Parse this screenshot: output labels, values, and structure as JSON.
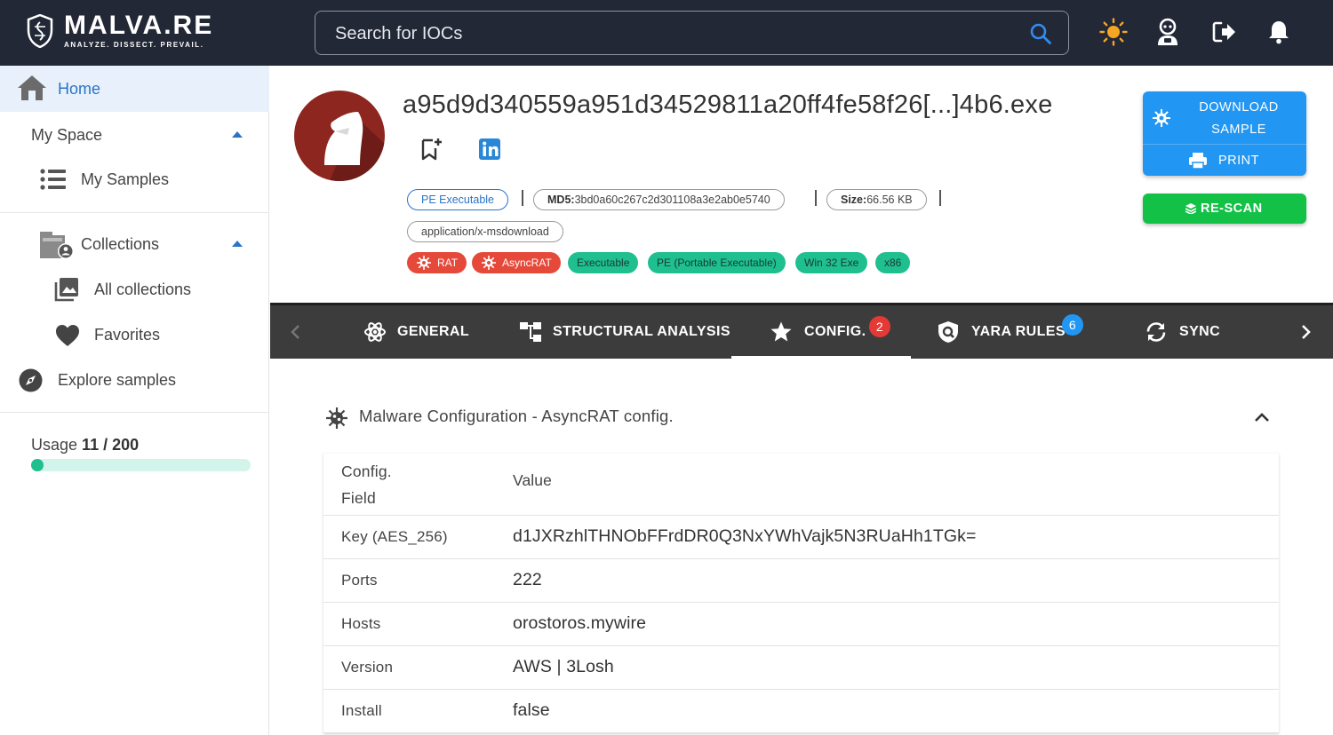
{
  "header": {
    "logo_name": "MALVA.RE",
    "logo_tagline": "ANALYZE. DISSECT. PREVAIL.",
    "search_placeholder": "Search for IOCs",
    "icons": [
      "sun-icon",
      "robot-icon",
      "logout-icon",
      "bell-icon"
    ]
  },
  "sidebar": {
    "home": "Home",
    "my_space": "My Space",
    "my_samples": "My Samples",
    "collections": "Collections",
    "all_collections": "All collections",
    "favorites": "Favorites",
    "explore": "Explore samples",
    "usage_label": "Usage",
    "usage_value": "11 / 200",
    "usage_used": 11,
    "usage_total": 200
  },
  "sample": {
    "title": "a95d9d340559a951d34529811a20ff4fe58f26[...]4b6.exe",
    "file_type": "PE Executable",
    "md5_label": "MD5:",
    "md5_value": "3bd0a60c267c2d301108a3e2ab0e5740",
    "size_label": "Size:",
    "size_value": "66.56 KB",
    "mime": "application/x-msdownload",
    "tags": [
      {
        "label": "RAT",
        "kind": "red"
      },
      {
        "label": "AsyncRAT",
        "kind": "red"
      },
      {
        "label": "Executable",
        "kind": "green"
      },
      {
        "label": "PE (Portable Executable)",
        "kind": "green"
      },
      {
        "label": "Win 32 Exe",
        "kind": "green"
      },
      {
        "label": "x86",
        "kind": "green"
      }
    ]
  },
  "actions": {
    "download_line1": "DOWNLOAD",
    "download_line2": "SAMPLE",
    "print": "PRINT",
    "rescan": "RE-SCAN"
  },
  "tabs": [
    {
      "label": "GENERAL",
      "badge": ""
    },
    {
      "label": "STRUCTURAL ANALYSIS",
      "badge": ""
    },
    {
      "label": "CONFIG.",
      "badge": "2"
    },
    {
      "label": "YARA RULES",
      "badge": "6"
    },
    {
      "label": "SYNC",
      "badge": ""
    }
  ],
  "config": {
    "title": "Malware Configuration - AsyncRAT config.",
    "col_field_1": "Config.",
    "col_field_2": "Field",
    "col_value": "Value",
    "rows": [
      {
        "field": "Key (AES_256)",
        "value": "d1JXRzhlTHNObFFrdDR0Q3NxYWhVajk5N3RUaHh1TGk="
      },
      {
        "field": "Ports",
        "value": "222"
      },
      {
        "field": "Hosts",
        "value": "orostoros.mywire"
      },
      {
        "field": "Version",
        "value": "AWS | 3Losh"
      },
      {
        "field": "Install",
        "value": "false"
      }
    ]
  },
  "colors": {
    "header_bg": "#232837",
    "accent_blue": "#2196f3",
    "rescan_green": "#12c146",
    "tag_red": "#e5493a",
    "tag_green": "#1fbf8f",
    "tabs_bg": "#3c3c3c"
  }
}
